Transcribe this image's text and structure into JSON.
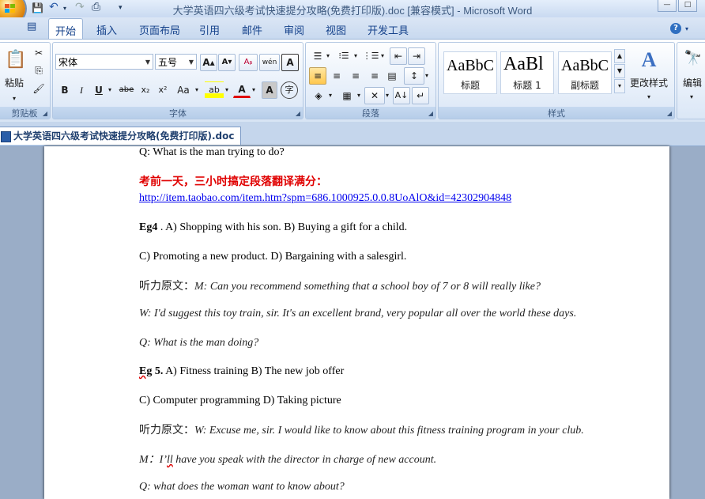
{
  "window": {
    "title": "大学英语四六级考试快速提分攻略(免费打印版).doc [兼容模式] - Microsoft Word",
    "min_glyph": "—",
    "max_glyph": "□"
  },
  "quick_access": {
    "save_glyph": "💾",
    "undo_glyph": "↶",
    "redo_glyph": "↷",
    "preview_glyph": "⎙",
    "more_glyph": "▾"
  },
  "tabs": [
    {
      "label": "开始"
    },
    {
      "label": "插入"
    },
    {
      "label": "页面布局"
    },
    {
      "label": "引用"
    },
    {
      "label": "邮件"
    },
    {
      "label": "审阅"
    },
    {
      "label": "视图"
    },
    {
      "label": "开发工具"
    }
  ],
  "help_glyph": "?",
  "ribbon": {
    "clipboard": {
      "label": "剪贴板",
      "paste_label": "粘贴",
      "cut_glyph": "✂",
      "copy_glyph": "⎘",
      "brush_glyph": "🖌"
    },
    "font": {
      "label": "字体",
      "font_name": "宋体",
      "font_size": "五号",
      "grow_glyph": "A▴",
      "shrink_glyph": "A▾",
      "clear_glyph": "Aᵦ",
      "phonetic_glyph": "wén",
      "border_glyph": "A",
      "bold": "B",
      "italic": "I",
      "underline": "U",
      "strike": "abe",
      "sub": "x₂",
      "sup": "x²",
      "case": "Aa",
      "highlight": "ab",
      "color": "A",
      "shade": "A",
      "enclose": "字"
    },
    "paragraph": {
      "label": "段落",
      "bullets": "☰",
      "numbering": "⁝☰",
      "multilevel": "⋮☰",
      "decrease": "⇤",
      "increase": "⇥",
      "align_left": "≡",
      "center": "≡",
      "align_right": "≡",
      "justify": "≡",
      "distribute": "▤",
      "spacing": "↕",
      "shading": "◈",
      "borders": "▦",
      "chinese_layout": "✕",
      "sort": "A↓",
      "marks": "↵"
    },
    "styles": {
      "label": "样式",
      "cards": [
        {
          "sample": "AaBbC",
          "name": "标题"
        },
        {
          "sample": "AaBl",
          "name": "标题 1"
        },
        {
          "sample": "AaBbC",
          "name": "副标题"
        }
      ],
      "change_styles_label": "更改样式"
    },
    "editing": {
      "label": "编辑",
      "find_glyph": "🔭"
    }
  },
  "document_tab": "大学英语四六级考试快速提分攻略(免费打印版).doc",
  "document": {
    "q1": "Q: What is the man trying to do?",
    "promo": "考前一天，三小时搞定段落翻译满分：",
    "url": "http://item.taobao.com/item.htm?spm=686.1000925.0.0.8UoAlO&id=42302904848",
    "eg4_label": "Eg4",
    "eg4_a": " . A) Shopping with his son. B) Buying a gift for a child.",
    "eg4_c": "C) Promoting a new product. D) Bargaining with a salesgirl.",
    "orig_label": "听力原文：",
    "eg4_m": "M: Can you recommend something that a school boy of 7 or 8 will really like?",
    "eg4_w": "W: I'd suggest this toy train, sir. It's an excellent brand, very popular all over the world these days.",
    "eg4_q": "Q: What is the man doing?",
    "eg5_label": "Eg",
    "eg5_num": " 5.",
    "eg5_a": " A) Fitness training B) The new job offer",
    "eg5_c": "C) Computer programming D) Taking picture",
    "orig_label2": "听力原文：",
    "eg5_w": "W: Excuse me, sir. I would like to know about this fitness training program in your club.",
    "eg5_m_prefix": "M：I’",
    "eg5_m_ll": "ll",
    "eg5_m_rest": " have you speak with the director  in charge  of new account.",
    "eg5_q": "Q: what does the woman want to know about?"
  }
}
